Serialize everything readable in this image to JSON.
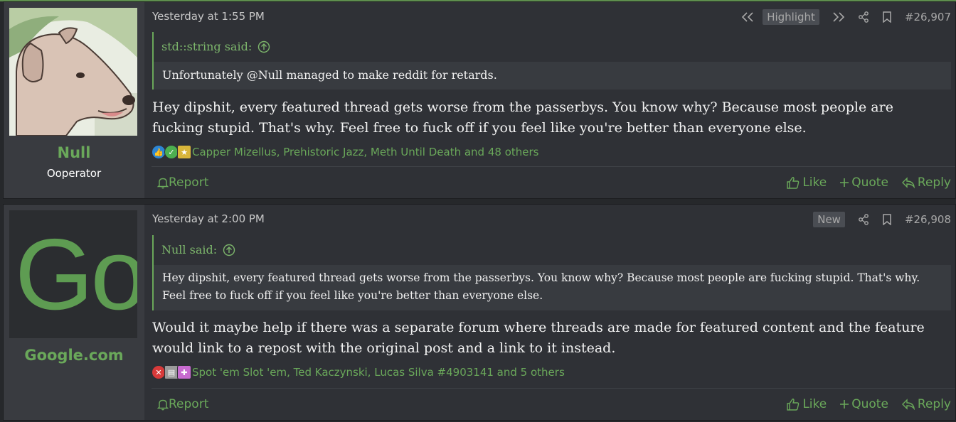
{
  "posts": [
    {
      "username": "Null",
      "user_title": "Ooperator",
      "date": "Yesterday at 1:55 PM",
      "highlight_badge": "Highlight",
      "post_number": "#26,907",
      "quote": {
        "author": "std::string said:",
        "text": "Unfortunately @Null managed to make reddit for retards."
      },
      "body": "Hey dipshit, every featured thread gets worse from the passerbys. You know why? Because most people are fucking stupid. That's why. Feel free to fuck off if you feel like you're better than everyone else.",
      "reactions": "Capper Mizellus, Prehistoric Jazz, Meth Until Death and 48 others",
      "reaction_icons": [
        "thumbs-up-icon",
        "check-icon",
        "medal-icon"
      ],
      "actions": {
        "report": "Report",
        "like": "Like",
        "quote": "Quote",
        "reply": "Reply"
      }
    },
    {
      "username": "Google.com",
      "avatar_text": "Go",
      "date": "Yesterday at 2:00 PM",
      "new_badge": "New",
      "post_number": "#26,908",
      "quote": {
        "author": "Null said:",
        "text": "Hey dipshit, every featured thread gets worse from the passerbys. You know why? Because most people are fucking stupid. That's why. Feel free to fuck off if you feel like you're better than everyone else."
      },
      "body": "Would it maybe help if there was a separate forum where threads are made for featured content and the feature would link to a repost with the original post and a link to it instead.",
      "reactions": "Spot 'em Slot 'em, Ted Kaczynski, Lucas Silva #4903141 and 5 others",
      "reaction_icons": [
        "x-icon",
        "book-icon",
        "puzzle-icon"
      ],
      "actions": {
        "report": "Report",
        "like": "Like",
        "quote": "Quote",
        "reply": "Reply"
      }
    }
  ],
  "colors": {
    "accent": "#6aa85a",
    "background": "#26282b",
    "post_bg": "#2f3136",
    "user_cell_bg": "#393b40"
  }
}
